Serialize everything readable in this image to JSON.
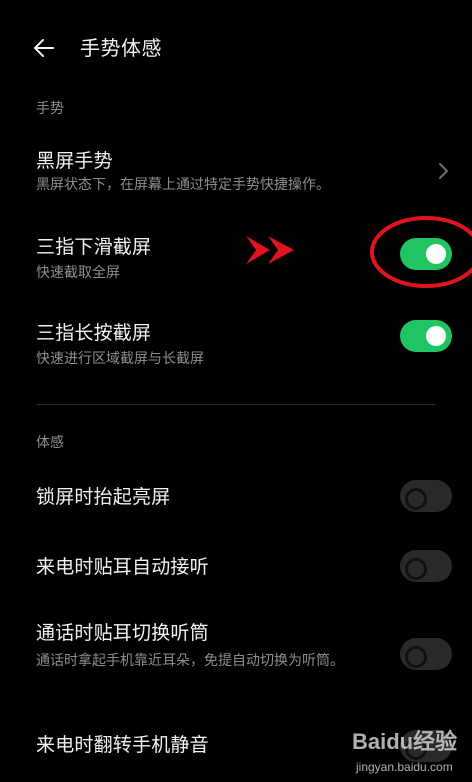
{
  "header": {
    "back_icon": "arrow-left-icon",
    "title": "手势体感"
  },
  "sections": [
    {
      "title": "手势",
      "items": [
        {
          "title": "黑屏手势",
          "subtitle": "黑屏状态下，在屏幕上通过特定手势快捷操作。",
          "control": "chevron-right-icon"
        },
        {
          "title": "三指下滑截屏",
          "subtitle": "快速截取全屏",
          "toggle": true
        },
        {
          "title": "三指长按截屏",
          "subtitle": "快速进行区域截屏与长截屏",
          "toggle": true
        }
      ]
    },
    {
      "title": "体感",
      "items": [
        {
          "title": "锁屏时抬起亮屏",
          "toggle": false
        },
        {
          "title": "来电时贴耳自动接听",
          "toggle": false
        },
        {
          "title": "通话时贴耳切换听筒",
          "subtitle": "通话时拿起手机靠近耳朵，免提自动切换为听筒。",
          "toggle": false
        },
        {
          "title": "来电时翻转手机静音",
          "toggle": false
        }
      ]
    }
  ],
  "colors": {
    "background": "#000000",
    "toggle_on": "#21c463",
    "toggle_off": "#2a2a2a",
    "annotation_red": "#e0141e"
  },
  "watermark": {
    "brand": "Baidu经验",
    "site": "jingyan.baidu.com"
  }
}
